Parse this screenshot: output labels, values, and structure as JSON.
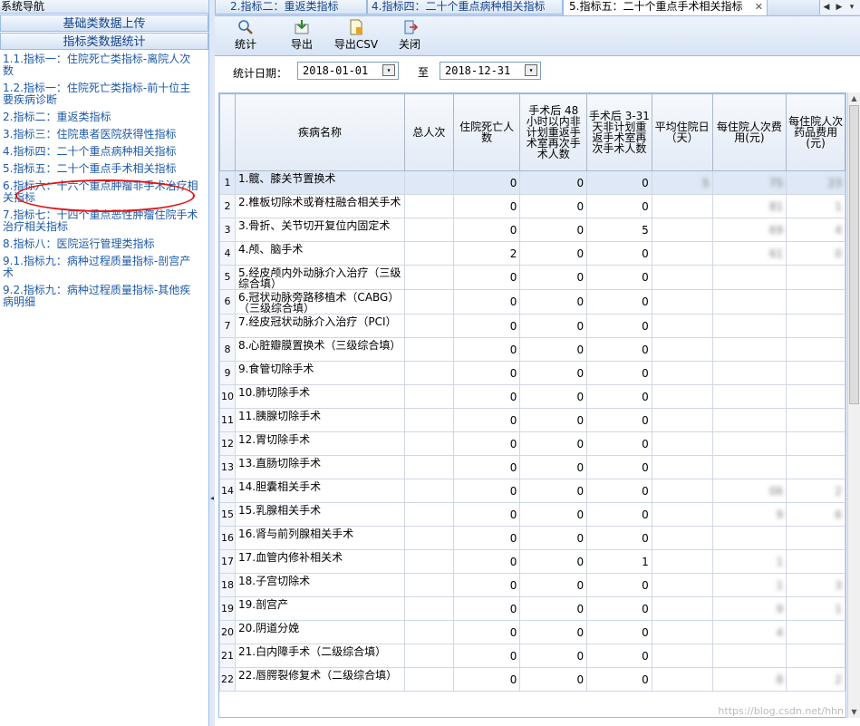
{
  "nav": {
    "title": "系统导航",
    "groups": [
      "基础类数据上传",
      "指标类数据统计"
    ],
    "items": [
      "1.1.指标一：住院死亡类指标-离院人次数",
      "1.2.指标一：住院死亡类指标-前十位主要疾病诊断",
      "2.指标二：重返类指标",
      "3.指标三：住院患者医院获得性指标",
      "4.指标四：二十个重点病种相关指标",
      "5.指标五：二十个重点手术相关指标",
      "6.指标六：十六个重点肿瘤非手术治疗相关指标",
      "7.指标七：十四个重点恶性肿瘤住院手术治疗相关指标",
      "8.指标八：医院运行管理类指标",
      "9.1.指标九：病种过程质量指标-剖宫产术",
      "9.2.指标九：病种过程质量指标-其他疾病明细"
    ]
  },
  "tabs": [
    {
      "label": "2.指标二：重返类指标"
    },
    {
      "label": "4.指标四：二十个重点病种相关指标"
    },
    {
      "label": "5.指标五：二十个重点手术相关指标"
    }
  ],
  "toolbar": {
    "stat": "统计",
    "export": "导出",
    "export_csv": "导出CSV",
    "close": "关闭"
  },
  "filter": {
    "label": "统计日期：",
    "start": "2018-01-01",
    "to": "至",
    "end": "2018-12-31"
  },
  "grid": {
    "headers": [
      "疾病名称",
      "总人次",
      "住院死亡人数",
      "手术后 48 小时以内非计划重返手术室再次手术人数",
      "手术后 3-31 天非计划重返手术室再次手术人数",
      "平均住院日（天）",
      "每住院人次费用(元)",
      "每住院人次药品费用(元)"
    ],
    "rows": [
      {
        "n": "1",
        "name": "1.髋、膝关节置换术",
        "total": "",
        "death": "0",
        "h48": "0",
        "d31": "0",
        "avg": "5",
        "fee": "75",
        "drug": "23"
      },
      {
        "n": "2",
        "name": "2.椎板切除术或脊柱融合相关手术",
        "total": "",
        "death": "0",
        "h48": "0",
        "d31": "0",
        "avg": "",
        "fee": "81",
        "drug": "1"
      },
      {
        "n": "3",
        "name": "3.骨折、关节切开复位内固定术",
        "total": "",
        "death": "0",
        "h48": "0",
        "d31": "5",
        "avg": "",
        "fee": "69",
        "drug": "4"
      },
      {
        "n": "4",
        "name": "4.颅、脑手术",
        "total": "",
        "death": "2",
        "h48": "0",
        "d31": "0",
        "avg": "",
        "fee": "61",
        "drug": "0"
      },
      {
        "n": "5",
        "name": "5.经皮颅内外动脉介入治疗（三级综合填）",
        "total": "",
        "death": "0",
        "h48": "0",
        "d31": "0",
        "avg": "",
        "fee": "",
        "drug": ""
      },
      {
        "n": "6",
        "name": "6.冠状动脉旁路移植术（CABG）（三级综合填）",
        "total": "",
        "death": "0",
        "h48": "0",
        "d31": "0",
        "avg": "",
        "fee": "",
        "drug": ""
      },
      {
        "n": "7",
        "name": "7.经皮冠状动脉介入治疗（PCI）",
        "total": "",
        "death": "0",
        "h48": "0",
        "d31": "0",
        "avg": "",
        "fee": "",
        "drug": ""
      },
      {
        "n": "8",
        "name": "8.心脏瓣膜置换术（三级综合填）",
        "total": "",
        "death": "0",
        "h48": "0",
        "d31": "0",
        "avg": "",
        "fee": "",
        "drug": ""
      },
      {
        "n": "9",
        "name": "9.食管切除手术",
        "total": "",
        "death": "0",
        "h48": "0",
        "d31": "0",
        "avg": "",
        "fee": "",
        "drug": ""
      },
      {
        "n": "10",
        "name": "10.肺切除手术",
        "total": "",
        "death": "0",
        "h48": "0",
        "d31": "0",
        "avg": "",
        "fee": "",
        "drug": ""
      },
      {
        "n": "11",
        "name": "11.胰腺切除手术",
        "total": "",
        "death": "0",
        "h48": "0",
        "d31": "0",
        "avg": "",
        "fee": "",
        "drug": ""
      },
      {
        "n": "12",
        "name": "12.胃切除手术",
        "total": "",
        "death": "0",
        "h48": "0",
        "d31": "0",
        "avg": "",
        "fee": "",
        "drug": ""
      },
      {
        "n": "13",
        "name": "13.直肠切除手术",
        "total": "",
        "death": "0",
        "h48": "0",
        "d31": "0",
        "avg": "",
        "fee": "",
        "drug": ""
      },
      {
        "n": "14",
        "name": "14.胆囊相关手术",
        "total": "",
        "death": "0",
        "h48": "0",
        "d31": "0",
        "avg": "",
        "fee": "06",
        "drug": "2"
      },
      {
        "n": "15",
        "name": "15.乳腺相关手术",
        "total": "",
        "death": "0",
        "h48": "0",
        "d31": "0",
        "avg": "",
        "fee": "9",
        "drug": "6"
      },
      {
        "n": "16",
        "name": "16.肾与前列腺相关手术",
        "total": "",
        "death": "0",
        "h48": "0",
        "d31": "0",
        "avg": "",
        "fee": "",
        "drug": ""
      },
      {
        "n": "17",
        "name": "17.血管内修补相关术",
        "total": "",
        "death": "0",
        "h48": "0",
        "d31": "1",
        "avg": "",
        "fee": "1",
        "drug": ""
      },
      {
        "n": "18",
        "name": "18.子宫切除术",
        "total": "",
        "death": "0",
        "h48": "0",
        "d31": "0",
        "avg": "",
        "fee": "1",
        "drug": "3"
      },
      {
        "n": "19",
        "name": "19.剖宫产",
        "total": "",
        "death": "0",
        "h48": "0",
        "d31": "0",
        "avg": "",
        "fee": "9",
        "drug": "1"
      },
      {
        "n": "20",
        "name": "20.阴道分娩",
        "total": "",
        "death": "0",
        "h48": "0",
        "d31": "0",
        "avg": "",
        "fee": "4",
        "drug": ""
      },
      {
        "n": "21",
        "name": "21.白内障手术（二级综合填）",
        "total": "",
        "death": "0",
        "h48": "0",
        "d31": "0",
        "avg": "",
        "fee": "",
        "drug": ""
      },
      {
        "n": "22",
        "name": "22.唇腭裂修复术（二级综合填）",
        "total": "",
        "death": "0",
        "h48": "0",
        "d31": "0",
        "avg": "",
        "fee": "8",
        "drug": "2"
      }
    ]
  },
  "watermark": "https://blog.csdn.net/hhn"
}
